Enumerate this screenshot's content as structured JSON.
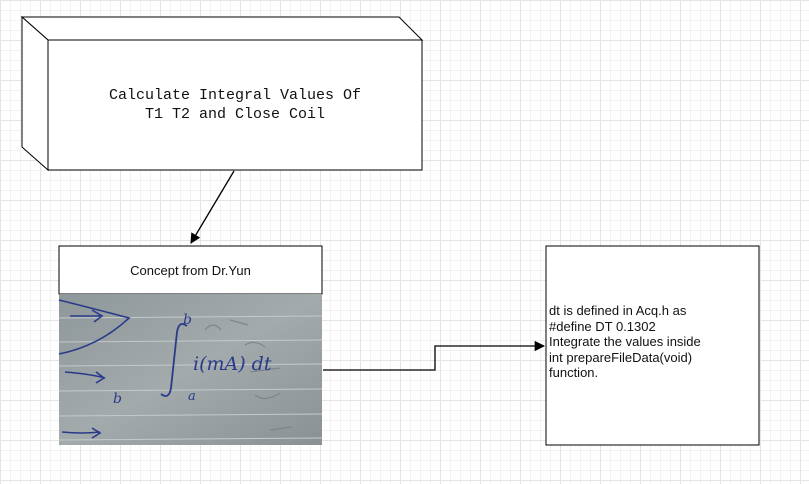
{
  "block": {
    "label": "Calculate Integral Values Of\n  T1 T2 and Close Coil"
  },
  "concept": {
    "title": "Concept from Dr.Yun",
    "photo_description": "handwritten integral on notebook paper",
    "handwriting": {
      "upper_limit": "b",
      "lower_limit": "a",
      "integrand": "i(mA) dt",
      "side_letter": "b"
    }
  },
  "note": {
    "text": "dt is defined in Acq.h as\n#define DT 0.1302\nIntegrate the values inside\nint prepareFileData(void)\nfunction."
  },
  "colors": {
    "stroke": "#000000",
    "photo_paper": "#9aa2a4",
    "ink": "#2a3a8a"
  }
}
